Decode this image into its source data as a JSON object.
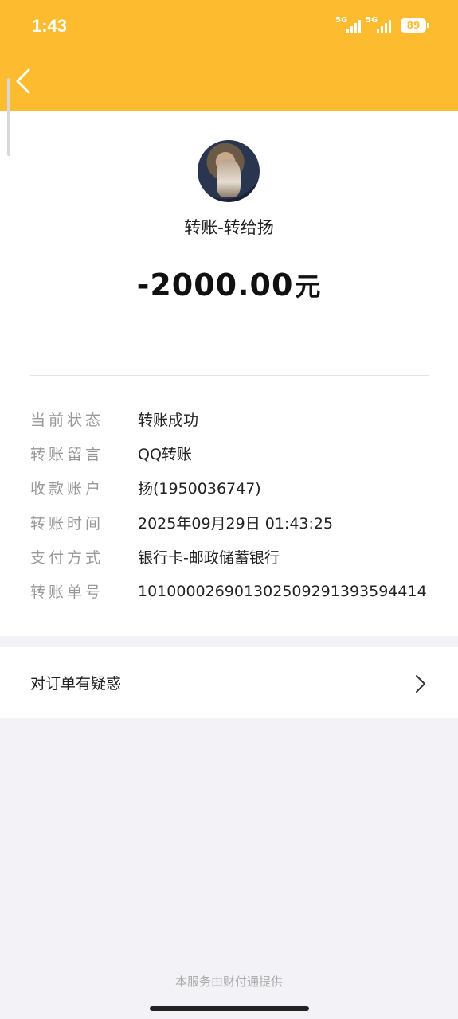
{
  "status_bar": {
    "time": "1:43",
    "network_1": "5G",
    "network_2": "5G",
    "battery": "89"
  },
  "header": {
    "back_icon": "chevron-left-icon"
  },
  "transfer": {
    "title": "转账-转给扬",
    "amount": "-2000.00",
    "unit": "元"
  },
  "details": [
    {
      "label": "当前状态",
      "value": "转账成功"
    },
    {
      "label": "转账留言",
      "value": "QQ转账"
    },
    {
      "label": "收款账户",
      "value": "扬(1950036747)"
    },
    {
      "label": "转账时间",
      "value": "2025年09月29日 01:43:25"
    },
    {
      "label": "支付方式",
      "value": "银行卡-邮政储蓄银行"
    },
    {
      "label": "转账单号",
      "value": "101000026901302509291393594414"
    }
  ],
  "question": {
    "label": "对订单有疑惑",
    "icon": "chevron-right-icon"
  },
  "footer": {
    "text": "本服务由财付通提供"
  },
  "colors": {
    "header": "#fdbb2f",
    "background": "#f2f2f7"
  }
}
